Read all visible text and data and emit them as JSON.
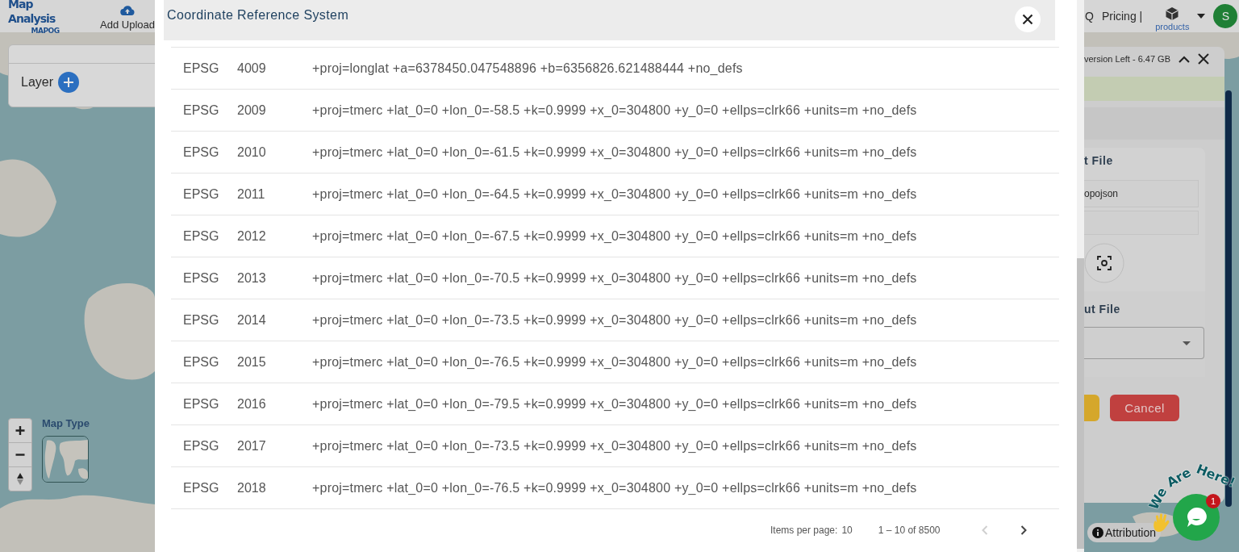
{
  "app_header": {
    "logo_title": "Map Analysis",
    "logo_brand": "MAPOG",
    "upload_label": "Add Upload",
    "nav_items": [
      {
        "label": "Q"
      },
      {
        "label": "Pricing |"
      }
    ],
    "products_label": "products",
    "avatar_initial": "S"
  },
  "layer_panel": {
    "title": "Layer"
  },
  "map_controls": {
    "map_type_label": "Map Type"
  },
  "side_panel": {
    "storage_text": "version Left - 6.47 GB",
    "input_section_title": "t File",
    "input_value": "opojson",
    "output_section_title": "ut File",
    "cancel_button": "Cancel"
  },
  "attribution": "Attribution",
  "chat_widget": {
    "greeting": "We Are Here!",
    "badge": "1"
  },
  "dialog": {
    "title": "Coordinate Reference System",
    "rows": [
      {
        "authority": "EPSG",
        "code": "4009",
        "definition": "+proj=longlat +a=6378450.047548896 +b=6356826.621488444 +no_defs"
      },
      {
        "authority": "EPSG",
        "code": "2009",
        "definition": "+proj=tmerc +lat_0=0 +lon_0=-58.5 +k=0.9999 +x_0=304800 +y_0=0 +ellps=clrk66 +units=m +no_defs"
      },
      {
        "authority": "EPSG",
        "code": "2010",
        "definition": "+proj=tmerc +lat_0=0 +lon_0=-61.5 +k=0.9999 +x_0=304800 +y_0=0 +ellps=clrk66 +units=m +no_defs"
      },
      {
        "authority": "EPSG",
        "code": "2011",
        "definition": "+proj=tmerc +lat_0=0 +lon_0=-64.5 +k=0.9999 +x_0=304800 +y_0=0 +ellps=clrk66 +units=m +no_defs"
      },
      {
        "authority": "EPSG",
        "code": "2012",
        "definition": "+proj=tmerc +lat_0=0 +lon_0=-67.5 +k=0.9999 +x_0=304800 +y_0=0 +ellps=clrk66 +units=m +no_defs"
      },
      {
        "authority": "EPSG",
        "code": "2013",
        "definition": "+proj=tmerc +lat_0=0 +lon_0=-70.5 +k=0.9999 +x_0=304800 +y_0=0 +ellps=clrk66 +units=m +no_defs"
      },
      {
        "authority": "EPSG",
        "code": "2014",
        "definition": "+proj=tmerc +lat_0=0 +lon_0=-73.5 +k=0.9999 +x_0=304800 +y_0=0 +ellps=clrk66 +units=m +no_defs"
      },
      {
        "authority": "EPSG",
        "code": "2015",
        "definition": "+proj=tmerc +lat_0=0 +lon_0=-76.5 +k=0.9999 +x_0=304800 +y_0=0 +ellps=clrk66 +units=m +no_defs"
      },
      {
        "authority": "EPSG",
        "code": "2016",
        "definition": "+proj=tmerc +lat_0=0 +lon_0=-79.5 +k=0.9999 +x_0=304800 +y_0=0 +ellps=clrk66 +units=m +no_defs"
      },
      {
        "authority": "EPSG",
        "code": "2017",
        "definition": "+proj=tmerc +lat_0=0 +lon_0=-73.5 +k=0.9999 +x_0=304800 +y_0=0 +ellps=clrk66 +units=m +no_defs"
      },
      {
        "authority": "EPSG",
        "code": "2018",
        "definition": "+proj=tmerc +lat_0=0 +lon_0=-76.5 +k=0.9999 +x_0=304800 +y_0=0 +ellps=clrk66 +units=m +no_defs"
      }
    ],
    "paginator": {
      "items_per_page_label": "Items per page:",
      "items_per_page": "10",
      "range": "1 – 10 of 8500",
      "previous_disabled": true,
      "next_disabled": false
    }
  }
}
